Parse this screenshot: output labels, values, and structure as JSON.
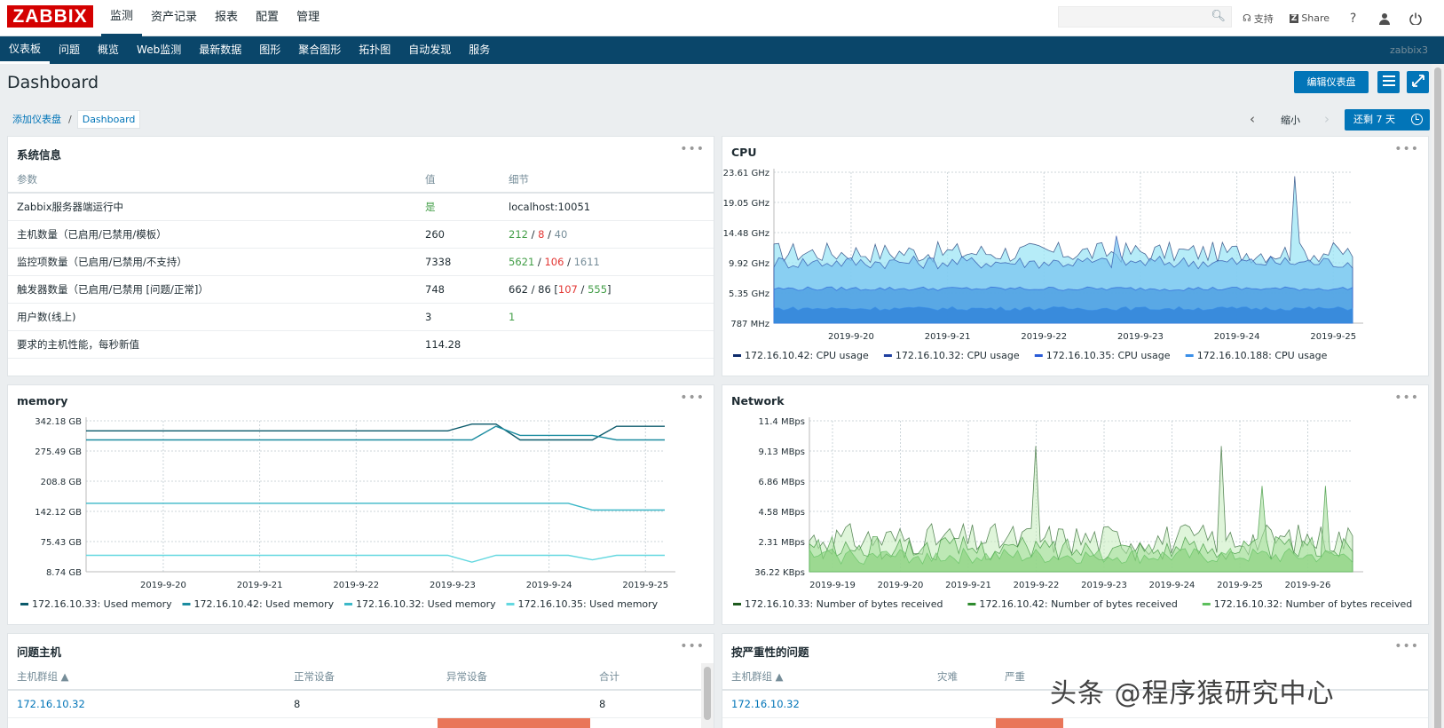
{
  "topbar": {
    "logo": "ZABBIX",
    "menu": [
      "监测",
      "资产记录",
      "报表",
      "配置",
      "管理"
    ],
    "support": "支持",
    "share": "Share",
    "help_icon": "question-icon",
    "user_icon": "user-icon",
    "logout_icon": "power-icon"
  },
  "submenu": {
    "items": [
      "仪表板",
      "问题",
      "概览",
      "Web监测",
      "最新数据",
      "图形",
      "聚合图形",
      "拓扑图",
      "自动发现",
      "服务"
    ],
    "user": "zabbix3"
  },
  "page": {
    "title": "Dashboard",
    "edit_button": "编辑仪表盘"
  },
  "breadcrumb": {
    "root": "添加仪表盘",
    "separator": "/",
    "current": "Dashboard"
  },
  "timenav": {
    "zoom_out": "缩小",
    "time_button": "还剩 7 天"
  },
  "sysinfo": {
    "title": "系统信息",
    "headers": [
      "参数",
      "值",
      "细节"
    ],
    "rows": [
      {
        "param": "Zabbix服务器端运行中",
        "value": "是",
        "detail": "localhost:10051"
      },
      {
        "param": "主机数量（已启用/已禁用/模板）",
        "value": "260",
        "d1": "212",
        "s1": " / ",
        "d2": "8",
        "s2": " / ",
        "d3": "40"
      },
      {
        "param": "监控项数量（已启用/已禁用/不支持）",
        "value": "7338",
        "d1": "5621",
        "s1": " / ",
        "d2": "106",
        "s2": " / ",
        "d3": "1611"
      },
      {
        "param": "触发器数量（已启用/已禁用 [问题/正常]）",
        "value": "748",
        "d0": "662 / 86 [",
        "d1": "107",
        "s1": " / ",
        "d2": "555",
        "d3": "]"
      },
      {
        "param": "用户数(线上)",
        "value": "3",
        "detail": "1"
      },
      {
        "param": "要求的主机性能，每秒新值",
        "value": "114.28",
        "detail": ""
      }
    ]
  },
  "problem_hosts": {
    "title": "问题主机",
    "headers": [
      "主机群组 ▲",
      "正常设备",
      "异常设备",
      "合计"
    ],
    "rows": [
      {
        "group": "172.16.10.32",
        "ok": "8",
        "problem": "",
        "total": "8"
      }
    ]
  },
  "severity": {
    "title": "按严重性的问题",
    "headers": [
      "主机群组 ▲",
      "灾难",
      "严重"
    ],
    "rows": [
      {
        "group": "172.16.10.32"
      }
    ]
  },
  "watermark": "头条 @程序猿研究中心",
  "colors": {
    "accent": "#0275b8",
    "navy": "#0a466a",
    "logo": "#d40000"
  },
  "chart_data": [
    {
      "type": "area",
      "title": "CPU",
      "y_ticks": [
        "23.61 GHz",
        "19.05 GHz",
        "14.48 GHz",
        "9.92 GHz",
        "5.35 GHz",
        "787 MHz"
      ],
      "x_ticks": [
        "2019-9-20",
        "2019-9-21",
        "2019-9-22",
        "2019-9-23",
        "2019-9-24",
        "2019-9-25"
      ],
      "legend": [
        "172.16.10.42: CPU usage",
        "172.16.10.32: CPU usage",
        "172.16.10.35: CPU usage",
        "172.16.10.188: CPU usage"
      ],
      "legend_colors": [
        "#0d2b6b",
        "#1f3fa0",
        "#2a5bd7",
        "#3a8fe8"
      ],
      "series": [
        {
          "name": "172.16.10.42: CPU usage",
          "base": 11.5,
          "noise": 1.6
        },
        {
          "name": "172.16.10.32: CPU usage",
          "base": 10.0,
          "noise": 1.0
        },
        {
          "name": "172.16.10.35: CPU usage",
          "base": 6.0,
          "noise": 0.3
        },
        {
          "name": "172.16.10.188: CPU usage",
          "base": 3.0,
          "noise": 0.3
        }
      ],
      "ylim": [
        0.787,
        23.61
      ]
    },
    {
      "type": "line",
      "title": "memory",
      "y_ticks": [
        "342.18 GB",
        "275.49 GB",
        "208.8 GB",
        "142.12 GB",
        "75.43 GB",
        "8.74 GB"
      ],
      "x_ticks": [
        "2019-9-20",
        "2019-9-21",
        "2019-9-22",
        "2019-9-23",
        "2019-9-24",
        "2019-9-25"
      ],
      "legend": [
        "172.16.10.33: Used memory",
        "172.16.10.42: Used memory",
        "172.16.10.32: Used memory",
        "172.16.10.35: Used memory"
      ],
      "legend_colors": [
        "#0b5a6b",
        "#1c8ca0",
        "#3cb8c8",
        "#64d8e0"
      ],
      "series": [
        {
          "name": "172.16.10.33: Used memory",
          "values": [
            320,
            320,
            320,
            320,
            320,
            320,
            320,
            320,
            320,
            320,
            320,
            320,
            320,
            320,
            320,
            320,
            335,
            335,
            300,
            300,
            300,
            300,
            330,
            330,
            330
          ]
        },
        {
          "name": "172.16.10.42: Used memory",
          "values": [
            300,
            300,
            300,
            300,
            300,
            300,
            300,
            300,
            300,
            300,
            300,
            300,
            300,
            300,
            300,
            300,
            300,
            330,
            310,
            310,
            310,
            310,
            300,
            300,
            300
          ]
        },
        {
          "name": "172.16.10.32: Used memory",
          "values": [
            160,
            160,
            160,
            160,
            160,
            160,
            160,
            160,
            160,
            160,
            160,
            160,
            160,
            160,
            160,
            160,
            160,
            160,
            160,
            160,
            160,
            145,
            145,
            145,
            145
          ]
        },
        {
          "name": "172.16.10.35: Used memory",
          "values": [
            45,
            45,
            45,
            45,
            45,
            45,
            45,
            45,
            45,
            45,
            45,
            45,
            45,
            45,
            45,
            45,
            30,
            45,
            45,
            45,
            45,
            35,
            45,
            45,
            45
          ]
        }
      ],
      "ylim": [
        8.74,
        342.18
      ]
    },
    {
      "type": "area",
      "title": "Network",
      "y_ticks": [
        "11.4 MBps",
        "9.13 MBps",
        "6.86 MBps",
        "4.58 MBps",
        "2.31 MBps",
        "36.22 KBps"
      ],
      "x_ticks": [
        "2019-9-19",
        "2019-9-20",
        "2019-9-21",
        "2019-9-22",
        "2019-9-23",
        "2019-9-24",
        "2019-9-25",
        "2019-9-26"
      ],
      "legend": [
        "172.16.10.33: Number of bytes received",
        "172.16.10.42: Number of bytes received",
        "172.16.10.32: Number of bytes received"
      ],
      "legend_colors": [
        "#1e5a1e",
        "#2e8b2e",
        "#5cbf5c"
      ],
      "series": [
        {
          "name": "172.16.10.33: Number of bytes received",
          "base": 2.5,
          "noise": 1.2
        },
        {
          "name": "172.16.10.42: Number of bytes received",
          "base": 1.8,
          "noise": 0.9
        },
        {
          "name": "172.16.10.32: Number of bytes received",
          "base": 1.2,
          "noise": 0.6
        }
      ],
      "ylim": [
        0.036,
        11.4
      ]
    }
  ]
}
